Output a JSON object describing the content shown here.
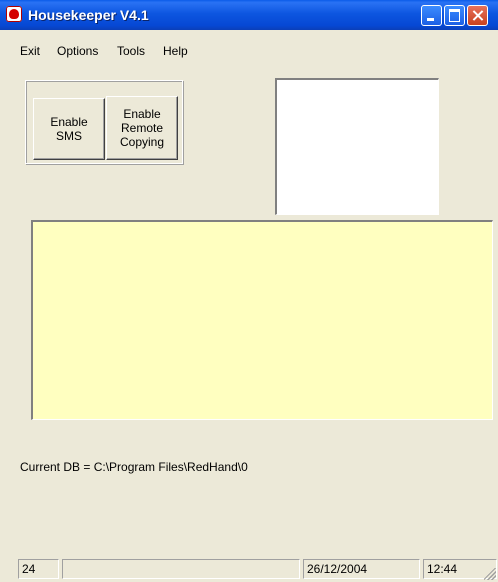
{
  "window": {
    "title": "Housekeeper V4.1",
    "icon": "redhand-app-icon",
    "controls": [
      "minimize-icon",
      "maximize-icon",
      "close-icon"
    ]
  },
  "menu": [
    "Exit",
    "Options",
    "Tools",
    "Help"
  ],
  "buttons": {
    "enable_sms": [
      "Enable",
      "SMS"
    ],
    "enable_remote_copying": [
      "Enable",
      "Remote",
      "Copying"
    ]
  },
  "log": {
    "background_color": "#ffffc0"
  },
  "current_db": "Current DB = C:\\Program Files\\RedHand\\0",
  "status": {
    "count": "24",
    "message": "",
    "date": "26/12/2004",
    "time": "12:44"
  },
  "colors": {
    "title_bar": "#0a55e0",
    "window_bg": "#ece9d8",
    "close_button": "#c8421f"
  }
}
